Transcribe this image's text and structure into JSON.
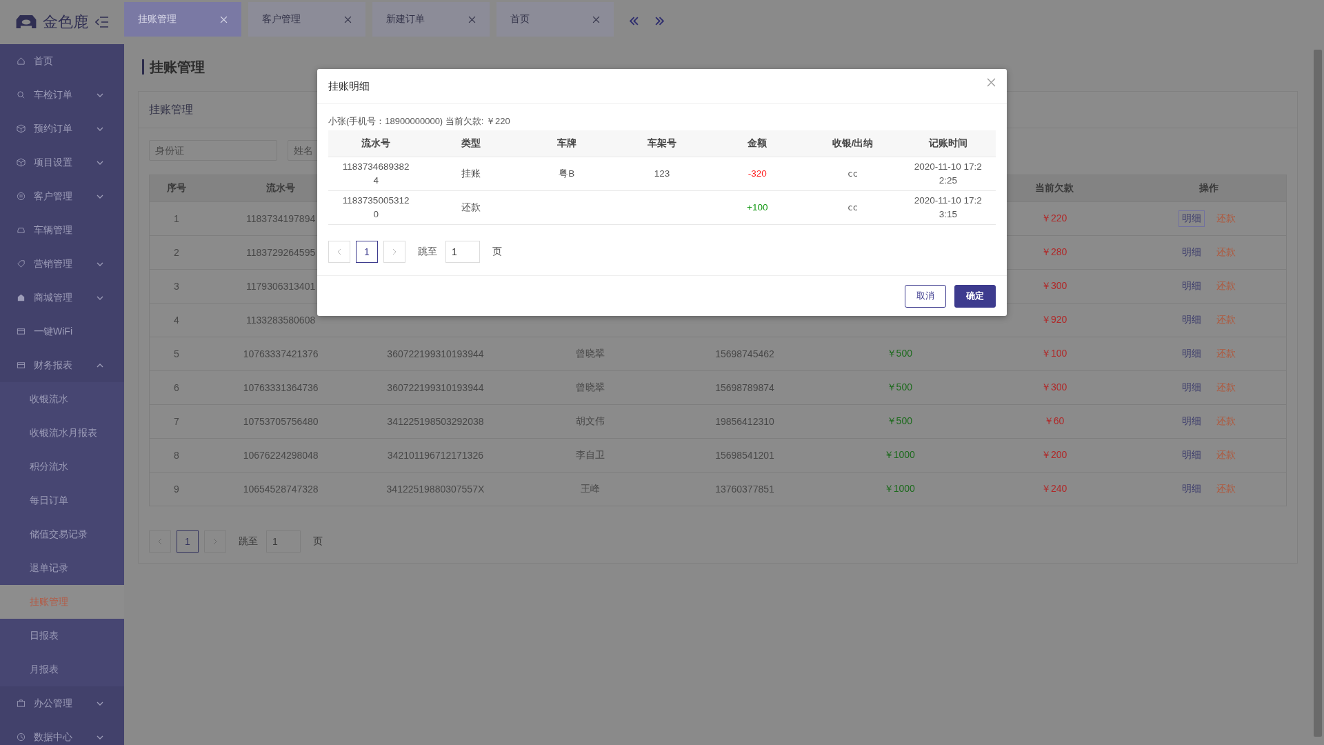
{
  "logo": {
    "text": "金色鹿"
  },
  "tabs": [
    {
      "label": "挂账管理",
      "selected": true
    },
    {
      "label": "客户管理",
      "selected": false
    },
    {
      "label": "新建订单",
      "selected": false
    },
    {
      "label": "首页",
      "selected": false
    }
  ],
  "sidebar": {
    "items": [
      {
        "label": "首页",
        "kind": "link"
      },
      {
        "label": "车检订单",
        "kind": "group",
        "expanded": false
      },
      {
        "label": "预约订单",
        "kind": "group",
        "expanded": false
      },
      {
        "label": "项目设置",
        "kind": "group",
        "expanded": false
      },
      {
        "label": "客户管理",
        "kind": "group",
        "expanded": false
      },
      {
        "label": "车辆管理",
        "kind": "link"
      },
      {
        "label": "营销管理",
        "kind": "group",
        "expanded": false
      },
      {
        "label": "商城管理",
        "kind": "group",
        "expanded": false
      },
      {
        "label": "一键WiFi",
        "kind": "link"
      },
      {
        "label": "财务报表",
        "kind": "group",
        "expanded": true,
        "children": [
          {
            "label": "收银流水",
            "selected": false
          },
          {
            "label": "收银流水月报表",
            "selected": false
          },
          {
            "label": "积分流水",
            "selected": false
          },
          {
            "label": "每日订单",
            "selected": false
          },
          {
            "label": "储值交易记录",
            "selected": false
          },
          {
            "label": "退单记录",
            "selected": false
          },
          {
            "label": "挂账管理",
            "selected": true
          },
          {
            "label": "日报表",
            "selected": false
          },
          {
            "label": "月报表",
            "selected": false
          }
        ]
      },
      {
        "label": "办公管理",
        "kind": "group",
        "expanded": false
      },
      {
        "label": "数据中心",
        "kind": "group",
        "expanded": false
      }
    ]
  },
  "page_title": "挂账管理",
  "card": {
    "title": "挂账管理",
    "filters": [
      {
        "placeholder": "身份证"
      },
      {
        "placeholder": "姓名"
      }
    ],
    "table": {
      "columns": [
        "序号",
        "流水号",
        "当前欠款",
        "操作"
      ],
      "rows": [
        {
          "no": "1",
          "serial": "1183734197894",
          "debt": "￥220",
          "actions": [
            {
              "label": "明细",
              "focused": true
            },
            {
              "label": "还款",
              "focused": false
            }
          ]
        },
        {
          "no": "2",
          "serial": "1183729264595",
          "debt": "￥280",
          "actions": [
            {
              "label": "明细",
              "focused": false
            },
            {
              "label": "还款",
              "focused": false
            }
          ]
        },
        {
          "no": "3",
          "serial": "1179306313401",
          "debt": "￥300",
          "actions": [
            {
              "label": "明细",
              "focused": false
            },
            {
              "label": "还款",
              "focused": false
            }
          ]
        },
        {
          "no": "4",
          "serial": "1133283580608",
          "debt": "￥920",
          "actions": [
            {
              "label": "明细",
              "focused": false
            },
            {
              "label": "还款",
              "focused": false
            }
          ]
        },
        {
          "no": "5",
          "serial": "10763337421376",
          "column_3": "360722199310193944",
          "column_4": "曾晓翠",
          "column_5": "15698745462",
          "column_6": "￥500",
          "debt": "￥100",
          "actions": [
            {
              "label": "明细",
              "focused": false
            },
            {
              "label": "还款",
              "focused": false
            }
          ]
        },
        {
          "no": "6",
          "serial": "10763331364736",
          "column_3": "360722199310193944",
          "column_4": "曾晓翠",
          "column_5": "15698789874",
          "column_6": "￥500",
          "debt": "￥300",
          "actions": [
            {
              "label": "明细",
              "focused": false
            },
            {
              "label": "还款",
              "focused": false
            }
          ]
        },
        {
          "no": "7",
          "serial": "10753705756480",
          "column_3": "341225198503292038",
          "column_4": "胡文伟",
          "column_5": "19856412310",
          "column_6": "￥500",
          "debt": "￥60",
          "actions": [
            {
              "label": "明细",
              "focused": false
            },
            {
              "label": "还款",
              "focused": false
            }
          ]
        },
        {
          "no": "8",
          "serial": "10676224298048",
          "column_3": "342101196712171326",
          "column_4": "李自卫",
          "column_5": "15698541201",
          "column_6": "￥1000",
          "debt": "￥200",
          "actions": [
            {
              "label": "明细",
              "focused": false
            },
            {
              "label": "还款",
              "focused": false
            }
          ]
        },
        {
          "no": "9",
          "serial": "10654528747328",
          "column_3": "34122519880307557X",
          "column_4": "王峰",
          "column_5": "13760377851",
          "column_6": "￥1000",
          "debt": "￥240",
          "actions": [
            {
              "label": "明细",
              "focused": false
            },
            {
              "label": "还款",
              "focused": false
            }
          ]
        }
      ]
    },
    "pagination": {
      "page": "1",
      "jump_label": "跳至",
      "jump_value": "1",
      "page_unit": "页"
    }
  },
  "dialog": {
    "title": "挂账明细",
    "summary": "小张(手机号：18900000000) 当前欠款: ￥220",
    "table": {
      "columns": [
        "流水号",
        "类型",
        "车牌",
        "车架号",
        "金额",
        "收银/出纳",
        "记账时间"
      ],
      "rows": [
        {
          "kind": "charge",
          "serial": "11837346893824",
          "type": "挂账",
          "plate": "粤B",
          "vin": "123",
          "amount": "-320",
          "cashier": "cc",
          "time": "2020-11-10 17:22:25"
        },
        {
          "kind": "repayment",
          "serial": "11837350053120",
          "type": "还款",
          "amount": "+100",
          "cashier": "cc",
          "time": "2020-11-10 17:23:15"
        }
      ]
    },
    "pagination": {
      "page": "1",
      "jump_label": "跳至",
      "jump_value": "1",
      "page_unit": "页"
    },
    "buttons": [
      {
        "label": "取消",
        "kind": "secondary"
      },
      {
        "label": "确定",
        "kind": "primary"
      }
    ]
  }
}
